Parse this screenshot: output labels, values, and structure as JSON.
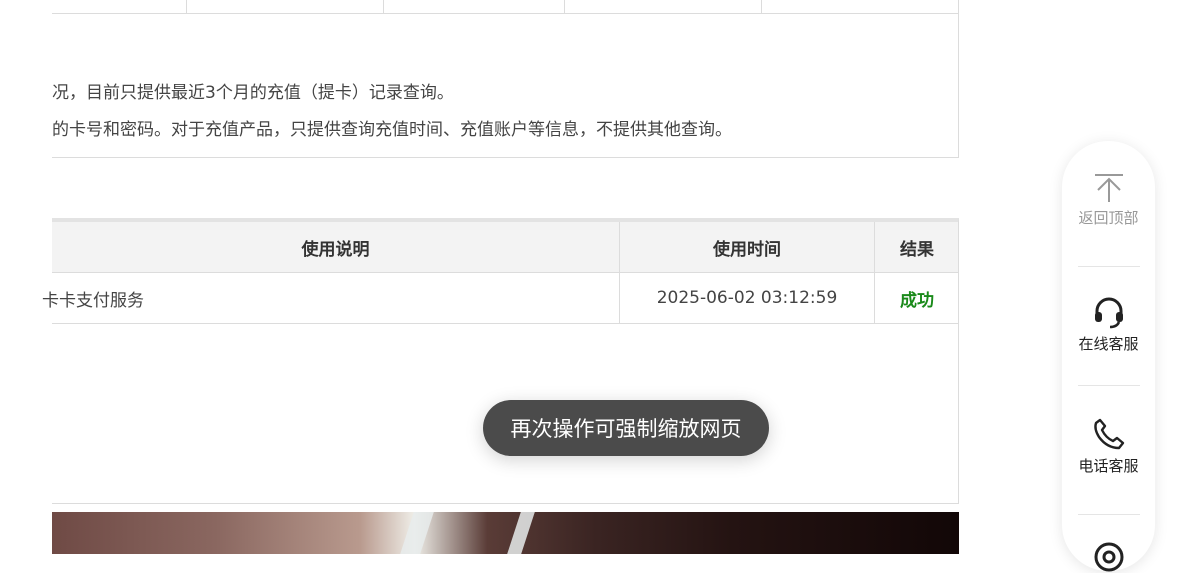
{
  "notice": {
    "line1": "况，目前只提供最近3个月的充值（提卡）记录查询。",
    "line2": "的卡号和密码。对于充值产品，只提供查询充值时间、充值账户等信息，不提供其他查询。"
  },
  "records": {
    "headers": {
      "desc": "使用说明",
      "time": "使用时间",
      "result": "结果"
    },
    "rows": [
      {
        "desc": "卡卡支付服务",
        "time": "2025-06-02 03:12:59",
        "result": "成功"
      }
    ]
  },
  "toast": {
    "text": "再次操作可强制缩放网页"
  },
  "float_bar": {
    "items": [
      {
        "icon": "arrow-up-icon",
        "label": "返回顶部"
      },
      {
        "icon": "headset-icon",
        "label": "在线客服"
      },
      {
        "icon": "phone-icon",
        "label": "电话客服"
      },
      {
        "icon": "qrcode-icon",
        "label": ""
      }
    ]
  },
  "colors": {
    "success": "#1a8a1a",
    "toast_bg": "#3c3c3c",
    "header_bg": "#f3f3f3"
  }
}
